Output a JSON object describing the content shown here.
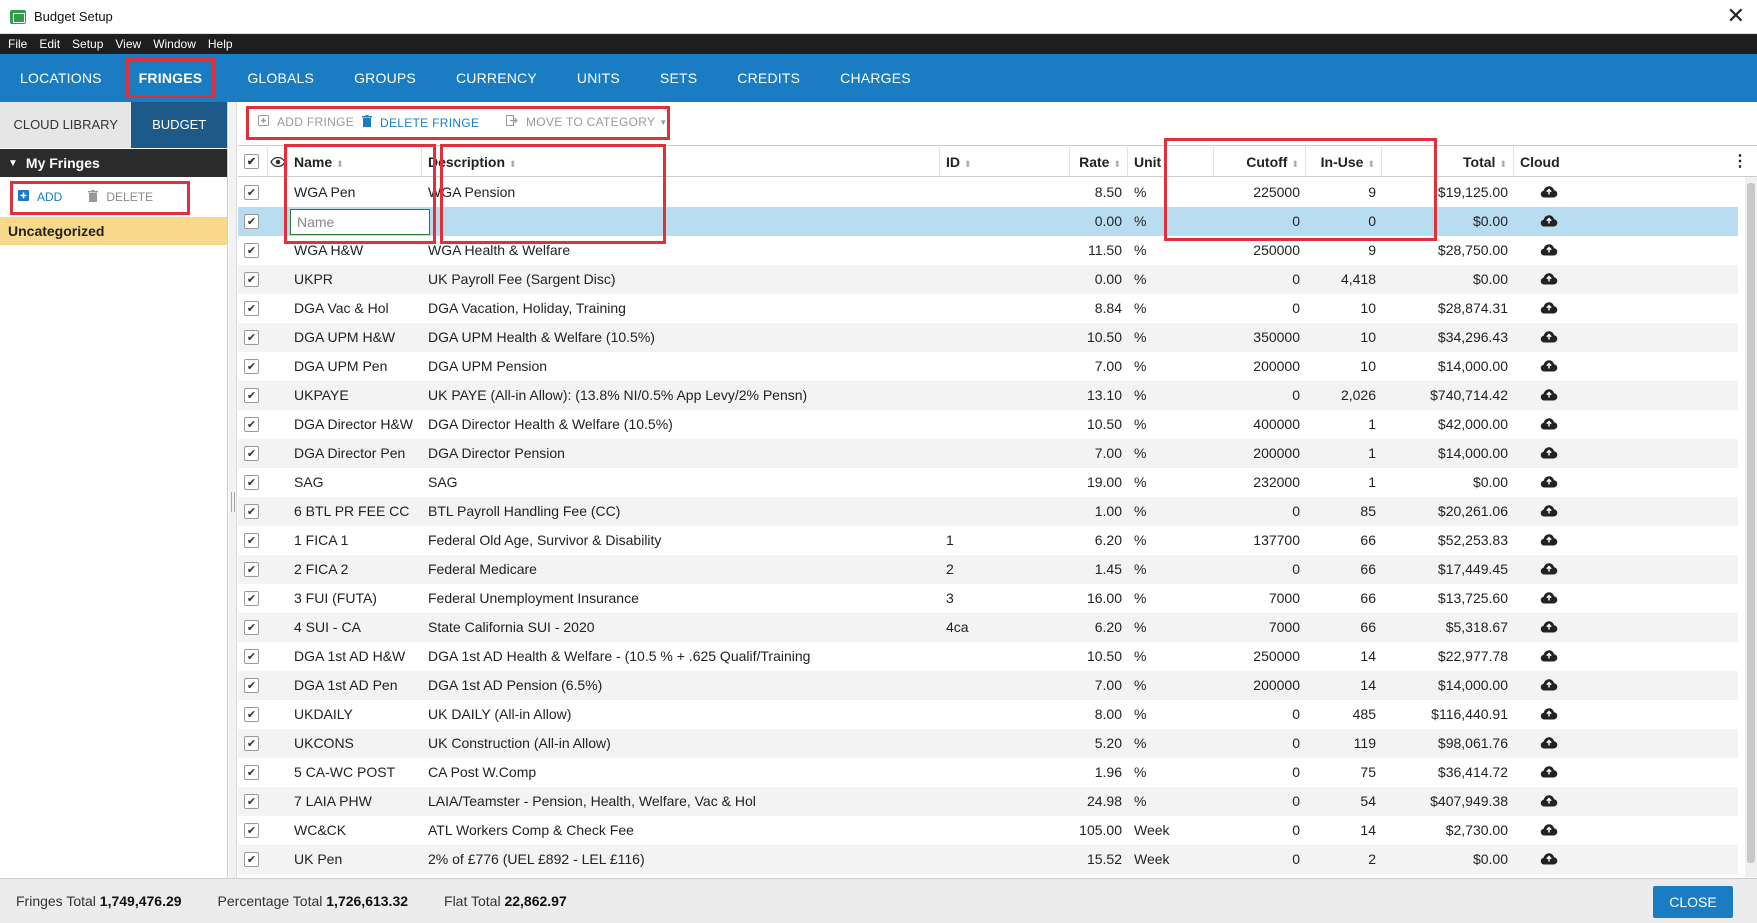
{
  "window": {
    "title": "Budget Setup",
    "close_glyph": "✕"
  },
  "menu": [
    "File",
    "Edit",
    "Setup",
    "View",
    "Window",
    "Help"
  ],
  "tabs": [
    {
      "label": "LOCATIONS"
    },
    {
      "label": "FRINGES",
      "active": true
    },
    {
      "label": "GLOBALS"
    },
    {
      "label": "GROUPS"
    },
    {
      "label": "CURRENCY"
    },
    {
      "label": "UNITS"
    },
    {
      "label": "SETS"
    },
    {
      "label": "CREDITS"
    },
    {
      "label": "CHARGES"
    }
  ],
  "left": {
    "cloud_library": "CLOUD LIBRARY",
    "budget": "BUDGET",
    "my_fringes": "My Fringes",
    "add": "ADD",
    "delete": "DELETE",
    "category": "Uncategorized"
  },
  "toolbar": {
    "add_fringe": "ADD FRINGE",
    "delete_fringe": "DELETE FRINGE",
    "move_to_category": "MOVE TO CATEGORY"
  },
  "columns": {
    "name": "Name",
    "description": "Description",
    "id": "ID",
    "rate": "Rate",
    "unit": "Unit",
    "cutoff": "Cutoff",
    "in_use": "In-Use",
    "total": "Total",
    "cloud": "Cloud"
  },
  "new_row": {
    "placeholder": "Name",
    "rate": "0.00",
    "unit": "%",
    "cutoff": "0",
    "in_use": "0",
    "total": "$0.00"
  },
  "rows": [
    {
      "name": "WGA Pen",
      "description": "WGA Pension",
      "id": "",
      "rate": "8.50",
      "unit": "%",
      "cutoff": "225000",
      "in_use": "9",
      "total": "$19,125.00"
    },
    {
      "new": true
    },
    {
      "name": "WGA H&W",
      "description": "WGA Health & Welfare",
      "id": "",
      "rate": "11.50",
      "unit": "%",
      "cutoff": "250000",
      "in_use": "9",
      "total": "$28,750.00"
    },
    {
      "name": "UKPR",
      "description": "UK Payroll Fee (Sargent Disc)",
      "id": "",
      "rate": "0.00",
      "unit": "%",
      "cutoff": "0",
      "in_use": "4,418",
      "total": "$0.00"
    },
    {
      "name": "DGA Vac & Hol",
      "description": "DGA Vacation, Holiday, Training",
      "id": "",
      "rate": "8.84",
      "unit": "%",
      "cutoff": "0",
      "in_use": "10",
      "total": "$28,874.31"
    },
    {
      "name": "DGA UPM H&W",
      "description": "DGA UPM Health & Welfare (10.5%)",
      "id": "",
      "rate": "10.50",
      "unit": "%",
      "cutoff": "350000",
      "in_use": "10",
      "total": "$34,296.43"
    },
    {
      "name": "DGA UPM Pen",
      "description": "DGA UPM Pension",
      "id": "",
      "rate": "7.00",
      "unit": "%",
      "cutoff": "200000",
      "in_use": "10",
      "total": "$14,000.00"
    },
    {
      "name": "UKPAYE",
      "description": "UK PAYE (All-in Allow): (13.8% NI/0.5% App Levy/2% Pensn)",
      "id": "",
      "rate": "13.10",
      "unit": "%",
      "cutoff": "0",
      "in_use": "2,026",
      "total": "$740,714.42"
    },
    {
      "name": "DGA Director H&W",
      "description": "DGA Director Health & Welfare (10.5%)",
      "id": "",
      "rate": "10.50",
      "unit": "%",
      "cutoff": "400000",
      "in_use": "1",
      "total": "$42,000.00"
    },
    {
      "name": "DGA Director Pen",
      "description": "DGA Director Pension",
      "id": "",
      "rate": "7.00",
      "unit": "%",
      "cutoff": "200000",
      "in_use": "1",
      "total": "$14,000.00"
    },
    {
      "name": "SAG",
      "description": "SAG",
      "id": "",
      "rate": "19.00",
      "unit": "%",
      "cutoff": "232000",
      "in_use": "1",
      "total": "$0.00"
    },
    {
      "name": "6 BTL PR FEE CC",
      "description": "BTL Payroll Handling Fee (CC)",
      "id": "",
      "rate": "1.00",
      "unit": "%",
      "cutoff": "0",
      "in_use": "85",
      "total": "$20,261.06"
    },
    {
      "name": "1 FICA 1",
      "description": "Federal Old Age, Survivor & Disability",
      "id": "1",
      "rate": "6.20",
      "unit": "%",
      "cutoff": "137700",
      "in_use": "66",
      "total": "$52,253.83"
    },
    {
      "name": "2 FICA 2",
      "description": "Federal Medicare",
      "id": "2",
      "rate": "1.45",
      "unit": "%",
      "cutoff": "0",
      "in_use": "66",
      "total": "$17,449.45"
    },
    {
      "name": "3 FUI (FUTA)",
      "description": "Federal Unemployment Insurance",
      "id": "3",
      "rate": "16.00",
      "unit": "%",
      "cutoff": "7000",
      "in_use": "66",
      "total": "$13,725.60"
    },
    {
      "name": "4 SUI - CA",
      "description": "State California SUI - 2020",
      "id": "4ca",
      "rate": "6.20",
      "unit": "%",
      "cutoff": "7000",
      "in_use": "66",
      "total": "$5,318.67"
    },
    {
      "name": "DGA 1st AD H&W",
      "description": "DGA 1st AD Health & Welfare - (10.5 % + .625 Qualif/Training",
      "id": "",
      "rate": "10.50",
      "unit": "%",
      "cutoff": "250000",
      "in_use": "14",
      "total": "$22,977.78"
    },
    {
      "name": "DGA 1st AD Pen",
      "description": "DGA 1st AD Pension (6.5%)",
      "id": "",
      "rate": "7.00",
      "unit": "%",
      "cutoff": "200000",
      "in_use": "14",
      "total": "$14,000.00"
    },
    {
      "name": "UKDAILY",
      "description": "UK DAILY (All-in Allow)",
      "id": "",
      "rate": "8.00",
      "unit": "%",
      "cutoff": "0",
      "in_use": "485",
      "total": "$116,440.91"
    },
    {
      "name": "UKCONS",
      "description": "UK Construction (All-in Allow)",
      "id": "",
      "rate": "5.20",
      "unit": "%",
      "cutoff": "0",
      "in_use": "119",
      "total": "$98,061.76"
    },
    {
      "name": "5 CA-WC POST",
      "description": "CA Post W.Comp",
      "id": "",
      "rate": "1.96",
      "unit": "%",
      "cutoff": "0",
      "in_use": "75",
      "total": "$36,414.72"
    },
    {
      "name": "7 LAIA PHW",
      "description": "LAIA/Teamster - Pension, Health, Welfare, Vac & Hol",
      "id": "",
      "rate": "24.98",
      "unit": "%",
      "cutoff": "0",
      "in_use": "54",
      "total": "$407,949.38"
    },
    {
      "name": "WC&CK",
      "description": "ATL Workers Comp & Check Fee",
      "id": "",
      "rate": "105.00",
      "unit": "Week",
      "cutoff": "0",
      "in_use": "14",
      "total": "$2,730.00"
    },
    {
      "name": "UK Pen",
      "description": "2% of £776 (UEL £892 - LEL £116)",
      "id": "",
      "rate": "15.52",
      "unit": "Week",
      "cutoff": "0",
      "in_use": "2",
      "total": "$0.00"
    }
  ],
  "footer": {
    "fringes_total_label": "Fringes Total",
    "fringes_total": "1,749,476.29",
    "percentage_total_label": "Percentage Total",
    "percentage_total": "1,726,613.32",
    "flat_total_label": "Flat Total",
    "flat_total": "22,862.97",
    "close": "CLOSE"
  },
  "colors": {
    "accent": "#1a7dc4",
    "highlight": "#e0303a",
    "category": "#f8d98b",
    "selected_row": "#b9ddf0"
  }
}
